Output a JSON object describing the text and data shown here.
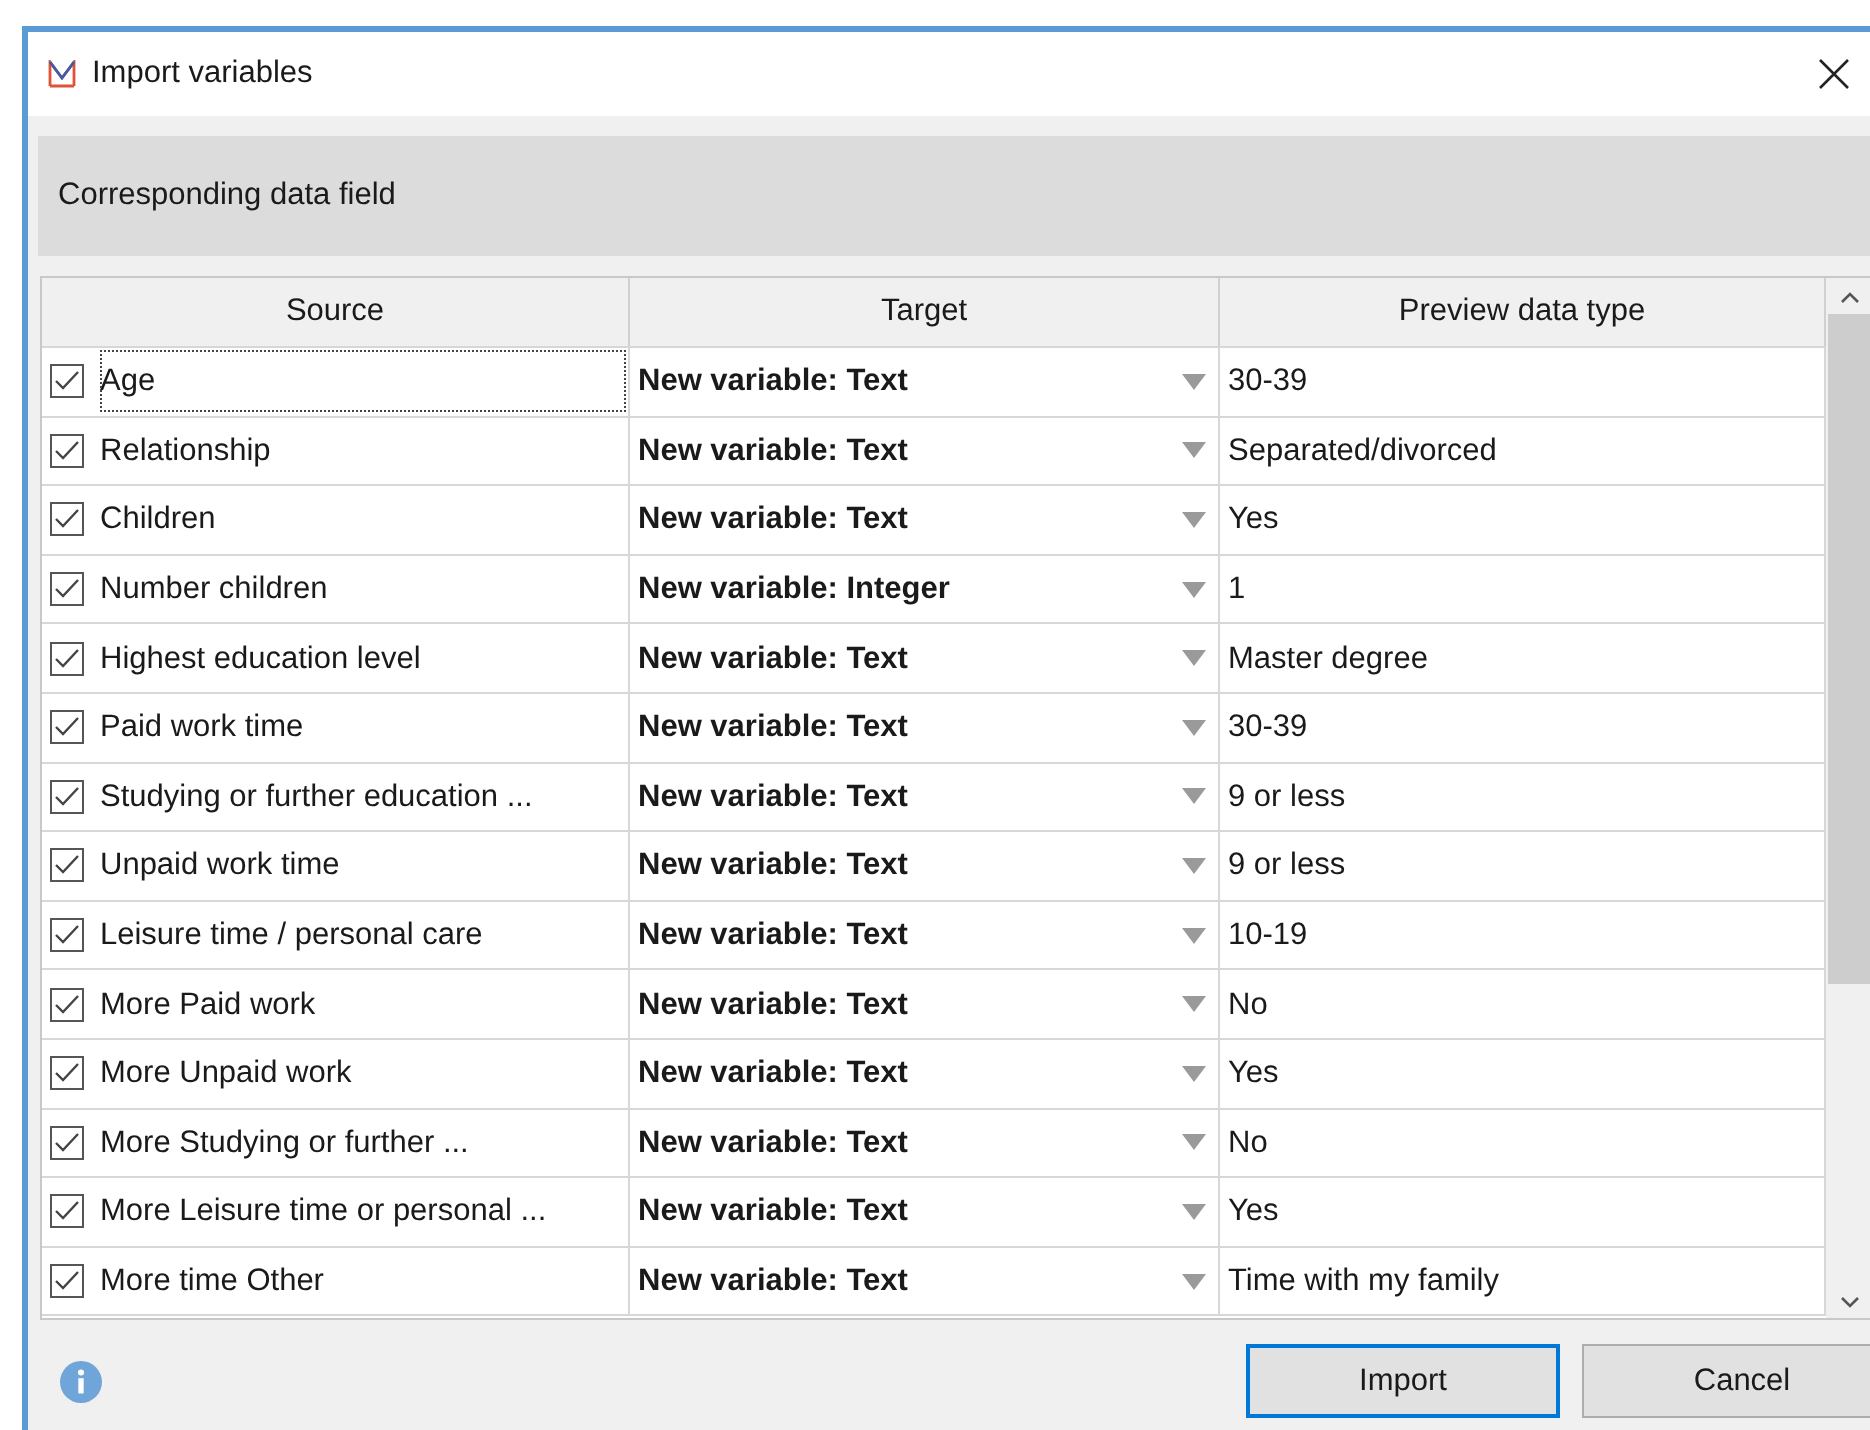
{
  "window": {
    "title": "Import variables"
  },
  "section_header": "Corresponding data field",
  "table": {
    "columns": [
      "Source",
      "Target",
      "Preview data type"
    ],
    "rows": [
      {
        "source": "Age",
        "checked": true,
        "focused": true,
        "target": "New variable: Text",
        "preview": "30-39"
      },
      {
        "source": "Relationship",
        "checked": true,
        "focused": false,
        "target": "New variable: Text",
        "preview": "Separated/divorced"
      },
      {
        "source": "Children",
        "checked": true,
        "focused": false,
        "target": "New variable: Text",
        "preview": "Yes"
      },
      {
        "source": "Number children",
        "checked": true,
        "focused": false,
        "target": "New variable: Integer",
        "preview": "1"
      },
      {
        "source": "Highest education level",
        "checked": true,
        "focused": false,
        "target": "New variable: Text",
        "preview": "Master degree"
      },
      {
        "source": "Paid work time",
        "checked": true,
        "focused": false,
        "target": "New variable: Text",
        "preview": "30-39"
      },
      {
        "source": "Studying or further education ...",
        "checked": true,
        "focused": false,
        "target": "New variable: Text",
        "preview": "9 or less"
      },
      {
        "source": "Unpaid work time",
        "checked": true,
        "focused": false,
        "target": "New variable: Text",
        "preview": "9 or less"
      },
      {
        "source": "Leisure time / personal care",
        "checked": true,
        "focused": false,
        "target": "New variable: Text",
        "preview": "10-19"
      },
      {
        "source": "More Paid work",
        "checked": true,
        "focused": false,
        "target": "New variable: Text",
        "preview": "No"
      },
      {
        "source": "More Unpaid work",
        "checked": true,
        "focused": false,
        "target": "New variable: Text",
        "preview": "Yes"
      },
      {
        "source": "More Studying or further ...",
        "checked": true,
        "focused": false,
        "target": "New variable: Text",
        "preview": "No"
      },
      {
        "source": "More Leisure time or personal ...",
        "checked": true,
        "focused": false,
        "target": "New variable: Text",
        "preview": "Yes"
      },
      {
        "source": "More time Other",
        "checked": true,
        "focused": false,
        "target": "New variable: Text",
        "preview": "Time with my family"
      }
    ]
  },
  "buttons": [
    {
      "label": "Import",
      "default": true
    },
    {
      "label": "Cancel",
      "default": false
    }
  ]
}
